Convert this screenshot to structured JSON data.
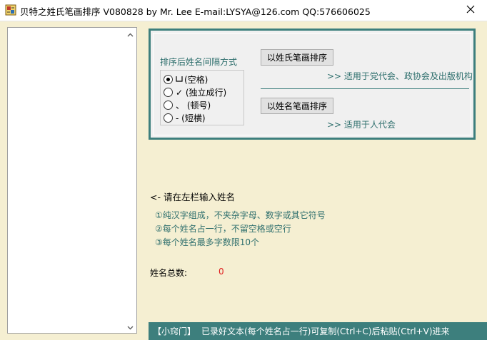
{
  "window": {
    "title": "贝特之姓氏笔画排序   V080828   by Mr. Lee   E-mail:LYSYA@126.com   QQ:576606025"
  },
  "options": {
    "separator_label": "排序后姓名间隔方式",
    "radios": [
      {
        "label": "(空格)",
        "symbol": "space",
        "checked": true
      },
      {
        "label": "✓ (独立成行)",
        "symbol": "check",
        "checked": false
      },
      {
        "label": "、 (顿号)",
        "symbol": "comma",
        "checked": false
      },
      {
        "label": "- (短横)",
        "symbol": "dash",
        "checked": false
      }
    ],
    "sort_surname_button": "以姓氏笔画排序",
    "sort_surname_hint": ">> 适用于党代会、政协会及出版机构",
    "sort_fullname_button": "以姓名笔画排序",
    "sort_fullname_hint": ">> 适用于人代会"
  },
  "instructions": {
    "title": "<- 请在左栏输入姓名",
    "items": [
      "①纯汉字组成，不夹杂字母、数字或其它符号",
      "②每个姓名占一行，不留空格或空行",
      "③每个姓名最多字数限10个"
    ]
  },
  "count": {
    "label": "姓名总数:",
    "value": "0"
  },
  "tip": {
    "tag": "【小窍门】",
    "text": "已录好文本(每个姓名占一行)可复制(Ctrl+C)后粘贴(Ctrl+V)进来"
  },
  "colors": {
    "teal": "#3d7f7d",
    "background": "#f5efd2",
    "count_value": "#e02020"
  }
}
